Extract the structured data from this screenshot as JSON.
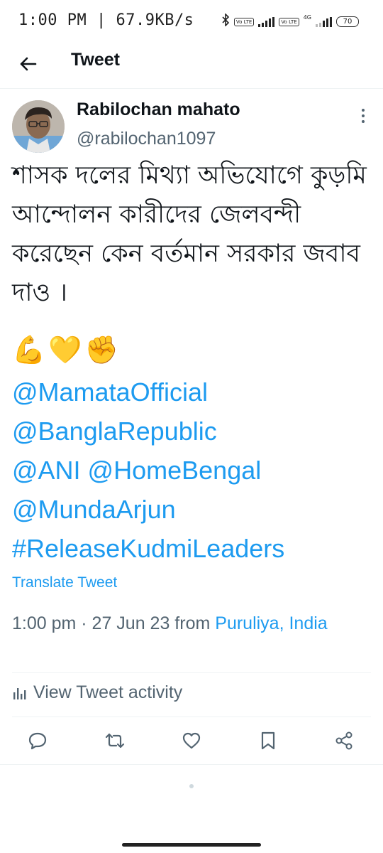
{
  "status_bar": {
    "time": "1:00 PM",
    "speed": "67.9KB/s",
    "battery": "70",
    "net_badge_1": "Vo LTE",
    "net_badge_2": "Vo LTE",
    "net_type": "4G"
  },
  "header": {
    "title": "Tweet"
  },
  "author": {
    "name": "Rabilochan mahato",
    "handle": "@rabilochan1097"
  },
  "tweet": {
    "text": "শাসক দলের মিথ্যা অভিযোগে কুড়মি আন্দোলন কারীদের জেলবন্দী করেছেন কেন বর্তমান সরকার জবাব দাও ।",
    "emojis": [
      "💪",
      "💛",
      "✊"
    ],
    "mentions": [
      "@MamataOfficial",
      "@BanglaRepublic",
      "@ANI @HomeBengal",
      "@MundaArjun",
      "#ReleaseKudmiLeaders"
    ],
    "translate_label": "Translate Tweet",
    "timestamp": "1:00 pm · 27 Jun 23 from ",
    "location": "Puruliya, India"
  },
  "activity": {
    "label": "View Tweet activity"
  },
  "actions": [
    "reply-icon",
    "retweet-icon",
    "like-icon",
    "bookmark-icon",
    "share-icon"
  ],
  "colors": {
    "accent": "#1d9bf0",
    "secondary_text": "#536471",
    "primary_text": "#0f1419"
  }
}
